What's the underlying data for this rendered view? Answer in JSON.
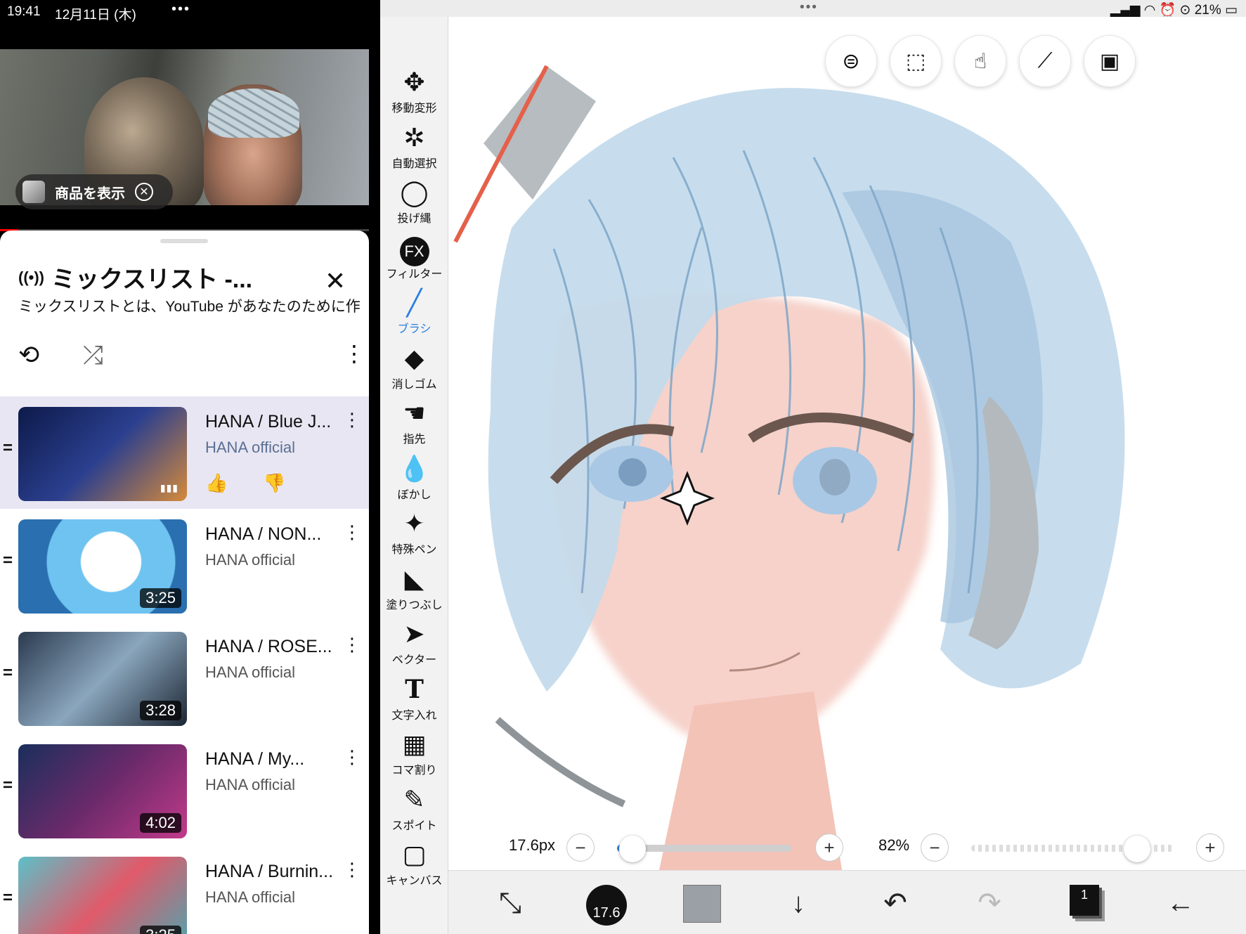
{
  "youtube": {
    "status": {
      "time": "19:41",
      "date": "12月11日 (木)",
      "dots": "•••"
    },
    "product_chip": {
      "label": "商品を表示"
    },
    "mix": {
      "title": "ミックスリスト -...",
      "description": "ミックスリストとは、YouTube があなたのために作"
    },
    "playlist": [
      {
        "title": "HANA / Blue J...",
        "channel": "HANA official",
        "duration": "",
        "active": true
      },
      {
        "title": "HANA / NON...",
        "channel": "HANA official",
        "duration": "3:25"
      },
      {
        "title": "HANA / ROSE...",
        "channel": "HANA official",
        "duration": "3:28"
      },
      {
        "title": "HANA / My...",
        "channel": "HANA official",
        "duration": "4:02"
      },
      {
        "title": "HANA / Burnin...",
        "channel": "HANA official",
        "duration": "3:25"
      }
    ]
  },
  "tools": [
    {
      "label": "移動変形",
      "icon": "move-icon"
    },
    {
      "label": "自動選択",
      "icon": "magic-wand-icon"
    },
    {
      "label": "投げ縄",
      "icon": "lasso-icon"
    },
    {
      "label": "フィルター",
      "icon": "fx-icon",
      "glyph": "FX"
    },
    {
      "label": "ブラシ",
      "icon": "brush-icon",
      "active": true
    },
    {
      "label": "消しゴム",
      "icon": "eraser-icon"
    },
    {
      "label": "指先",
      "icon": "finger-icon"
    },
    {
      "label": "ぼかし",
      "icon": "blur-drop-icon"
    },
    {
      "label": "特殊ペン",
      "icon": "special-pen-icon"
    },
    {
      "label": "塗りつぶし",
      "icon": "fill-bucket-icon"
    },
    {
      "label": "ベクター",
      "icon": "vector-arrow-icon"
    },
    {
      "label": "文字入れ",
      "icon": "text-icon",
      "glyph": "T"
    },
    {
      "label": "コマ割り",
      "icon": "panel-divide-icon"
    },
    {
      "label": "スポイト",
      "icon": "eyedropper-icon"
    },
    {
      "label": "キャンバス",
      "icon": "canvas-icon"
    }
  ],
  "canvas": {
    "ipad_status": {
      "dots": "•••",
      "battery": "21%"
    },
    "brush_size": "17.6px",
    "brush_size_badge": "17.6",
    "brush_size_fraction": 0.03,
    "opacity": "82%",
    "opacity_fraction": 0.82,
    "layer_number": "1",
    "colors": {
      "accent": "#2a7fe0",
      "hair": "#b9d4e8",
      "skin": "#f4c9c0",
      "current_color": "#9aa0a6"
    }
  }
}
